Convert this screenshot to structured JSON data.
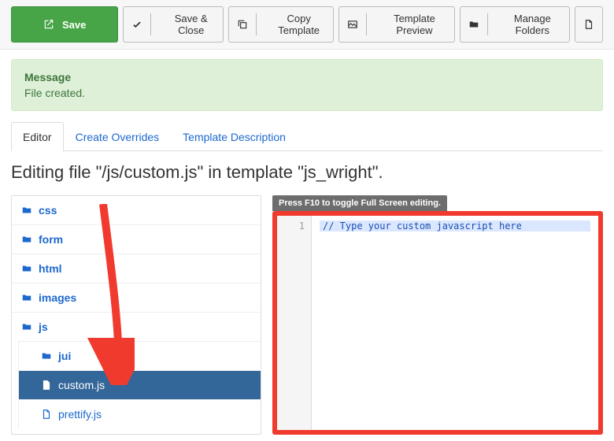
{
  "toolbar": {
    "save": "Save",
    "save_close": "Save & Close",
    "copy_template": "Copy Template",
    "template_preview": "Template Preview",
    "manage_folders": "Manage Folders"
  },
  "alert": {
    "title": "Message",
    "body": "File created."
  },
  "tabs": {
    "editor": "Editor",
    "overrides": "Create Overrides",
    "description": "Template Description"
  },
  "heading": "Editing file \"/js/custom.js\" in template \"js_wright\".",
  "tree": {
    "css": "css",
    "form": "form",
    "html": "html",
    "images": "images",
    "js": "js",
    "jui": "jui",
    "custom_js": "custom.js",
    "prettify_js": "prettify.js"
  },
  "editor": {
    "hint": "Press F10 to toggle Full Screen editing.",
    "line1_no": "1",
    "line1": "// Type your custom javascript here"
  }
}
